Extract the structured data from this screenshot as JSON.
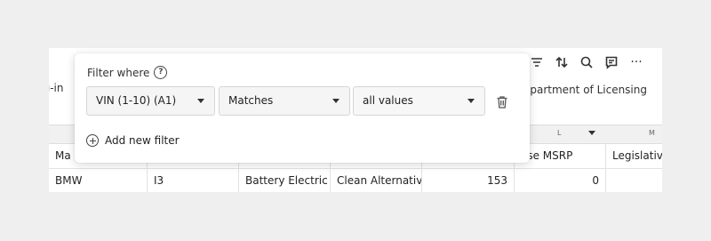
{
  "toolbar": {
    "icons": [
      "filter-icon",
      "sort-icon",
      "search-icon",
      "comment-icon",
      "more-icon"
    ],
    "more_label": "···"
  },
  "dataset": {
    "subtitle_left": "ug-in",
    "subtitle_right": "epartment of Licensing"
  },
  "grid": {
    "column_letters": {
      "L": "L",
      "M": "M"
    },
    "headers": [
      "Ma",
      "",
      "",
      "",
      "",
      "ase MSRP",
      "Legislative"
    ],
    "row": [
      "BMW",
      "I3",
      "Battery Electric",
      "Clean Alternativ",
      "153",
      "0",
      ""
    ]
  },
  "filter": {
    "title": "Filter where",
    "help": "?",
    "column_select": "VIN (1-10) (A1)",
    "operator_select": "Matches",
    "value_select": "all values",
    "add_label": "Add new filter"
  }
}
